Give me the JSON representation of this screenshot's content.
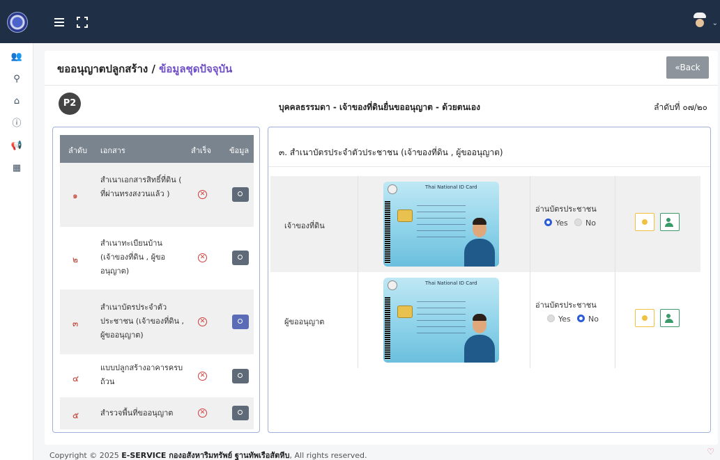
{
  "sidebar": {
    "items": [
      {
        "icon": "user-group-icon",
        "glyph": "👥"
      },
      {
        "icon": "map-pin-icon",
        "glyph": "⚲"
      },
      {
        "icon": "home-icon",
        "glyph": "⌂"
      },
      {
        "icon": "info-icon",
        "glyph": "ⓘ"
      },
      {
        "icon": "megaphone-icon",
        "glyph": "📢"
      },
      {
        "icon": "calendar-icon",
        "glyph": "▦"
      }
    ]
  },
  "header": {
    "breadcrumb_parent": "ขออนุญาตปลูกสร้าง /",
    "breadcrumb_current": "ข้อมูลชุดปัจจุบัน",
    "back_label": "«Back"
  },
  "case": {
    "badge": "P2",
    "title": "บุคคลธรรมดา - เจ้าของที่ดินยื่นขออนุญาต - ด้วยตนเอง",
    "sequence": "ลำดับที่ ๐๗/๒๐"
  },
  "doc_table": {
    "headers": {
      "no": "ลำดับ",
      "doc": "เอกสาร",
      "done": "สำเร็จ",
      "data": "ข้อมูล"
    },
    "rows": [
      {
        "no": "๑",
        "name": "สำเนาเอกสารสิทธิ์ที่ดิน ( ที่ผ่านทรงสงวนแล้ว )"
      },
      {
        "no": "๒",
        "name": "สำเนาทะเบียนบ้าน (เจ้าของที่ดิน , ผู้ขออนุญาต)"
      },
      {
        "no": "๓",
        "name": "สำเนาบัตรประจำตัวประชาชน (เจ้าของที่ดิน , ผู้ขออนุญาต)"
      },
      {
        "no": "๔",
        "name": "แบบปลูกสร้างอาคารครบถ้วน"
      },
      {
        "no": "๕",
        "name": "สำรวจพื้นที่ขออนุญาต"
      }
    ]
  },
  "detail": {
    "title": "๓. สำเนาบัตรประจำตัวประชาชน (เจ้าของที่ดิน , ผู้ขออนุญาต)",
    "id_card_title": "Thai National ID Card",
    "read_label": "อ่านบัตรประชาชน",
    "yes_label": "Yes",
    "no_label": "No",
    "persons": [
      {
        "label": "เจ้าของที่ดิน",
        "read_card": "Yes"
      },
      {
        "label": "ผู้ขออนุญาต",
        "read_card": "No"
      }
    ]
  },
  "footer": {
    "prefix": "Copyright © 2025",
    "brand": "E-SERVICE กองอสังหาริมทรัพย์ ฐานทัพเรือสัตหีบ",
    "suffix": ", All rights reserved."
  },
  "colors": {
    "topbar": "#1f2f45",
    "accent": "#6f4fc5",
    "panel_border": "#9fb0d8",
    "error": "#d23a3a"
  }
}
